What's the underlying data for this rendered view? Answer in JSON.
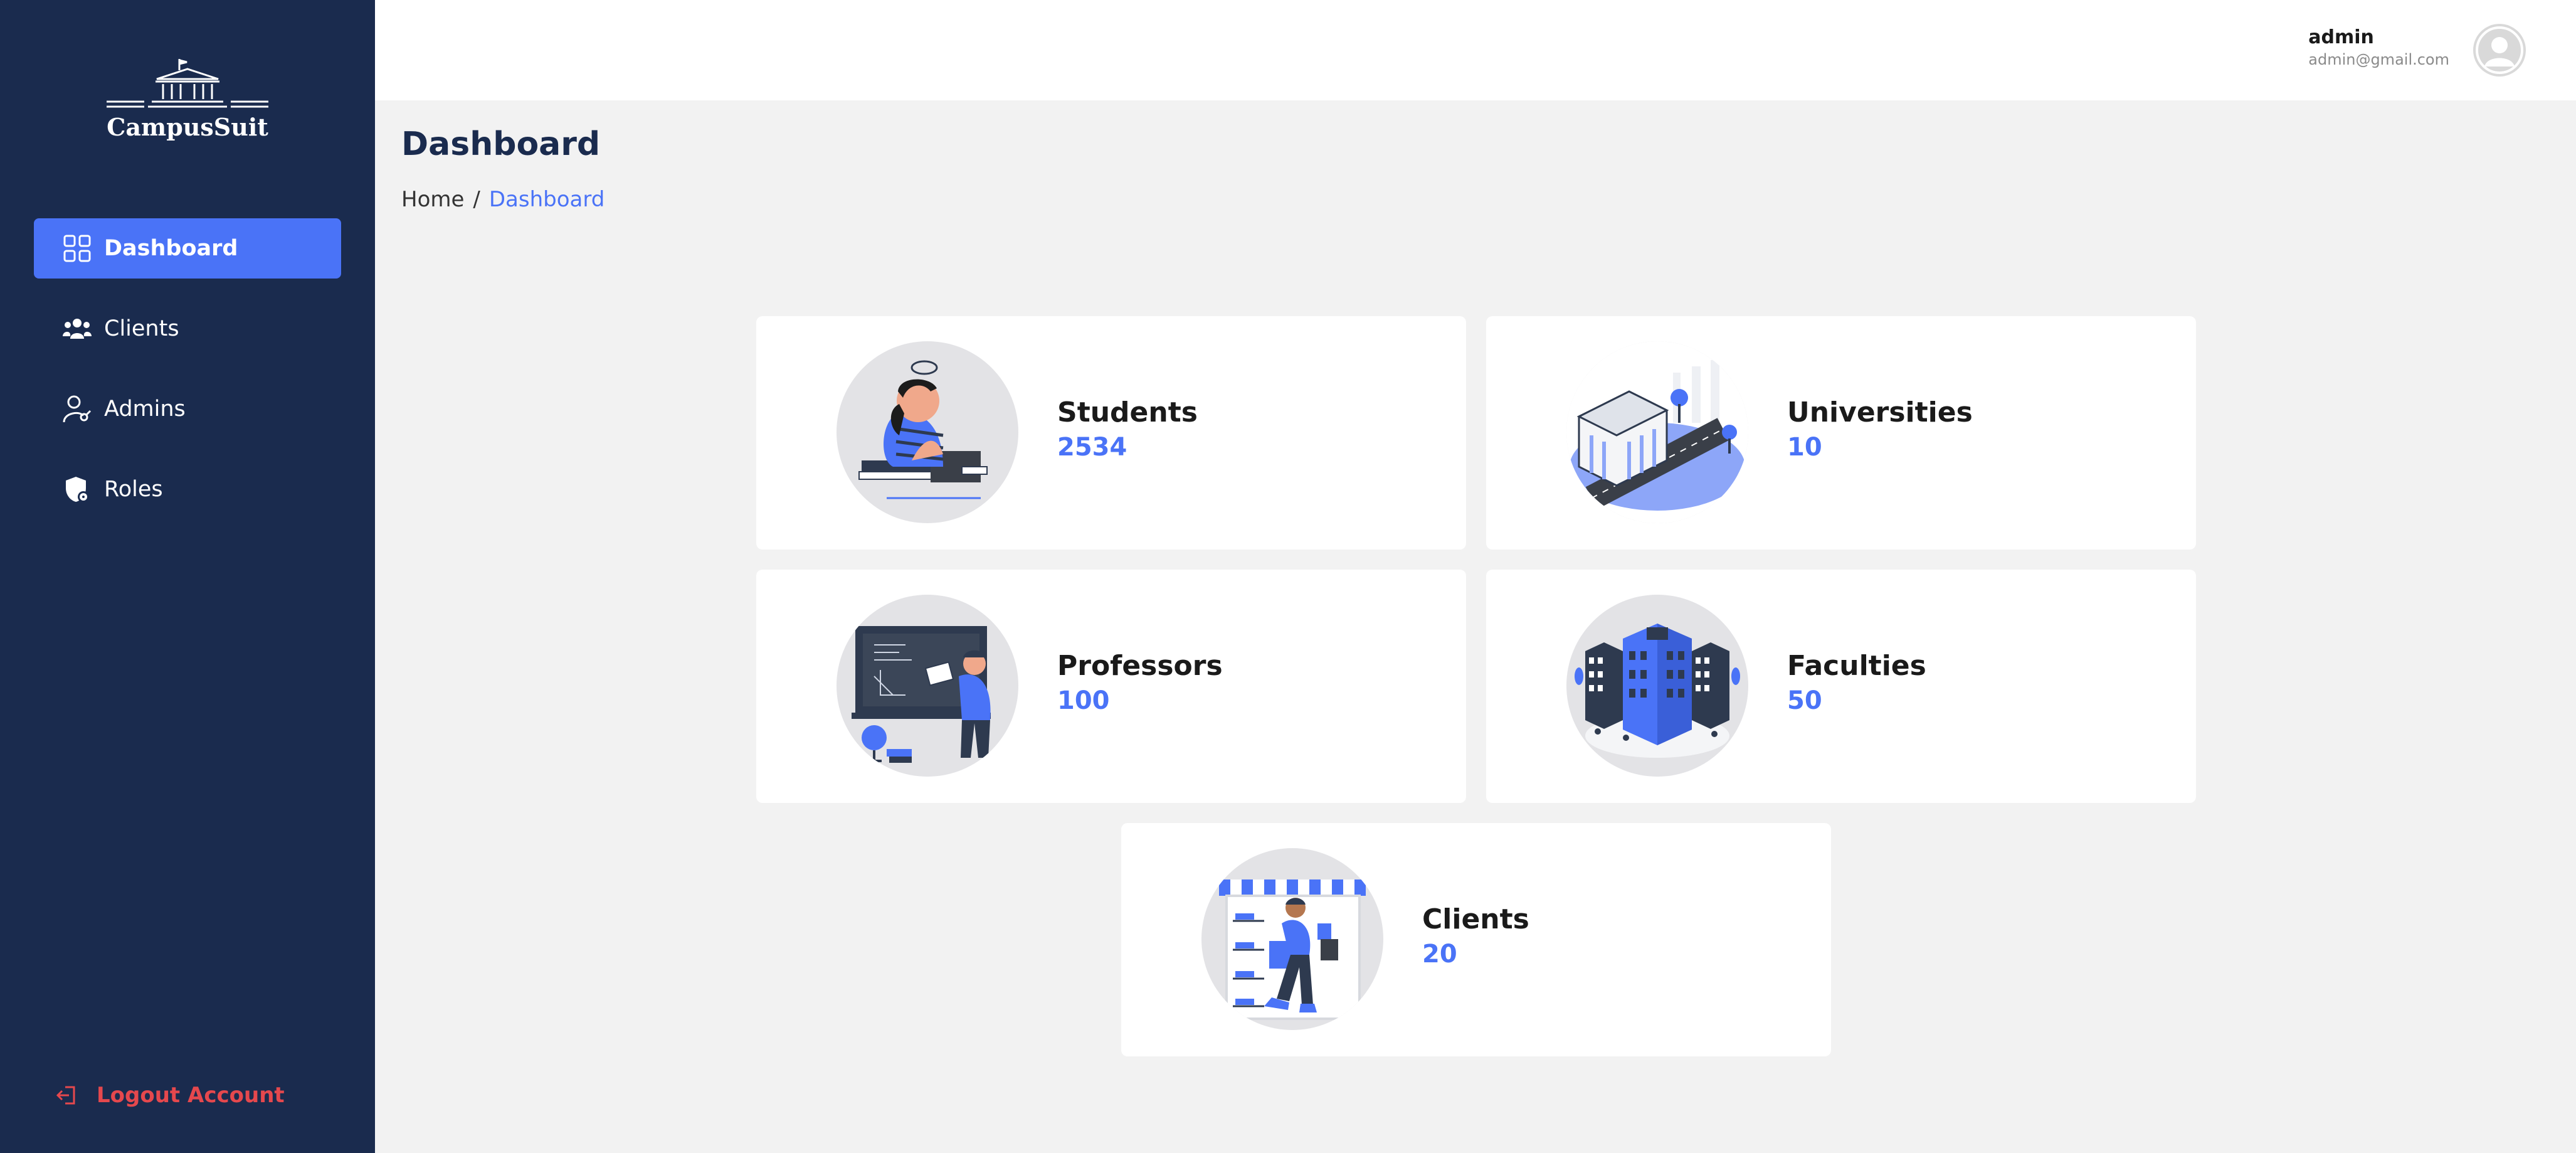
{
  "brand": {
    "name": "CampusSuit"
  },
  "sidebar": {
    "items": [
      {
        "label": "Dashboard",
        "icon": "dashboard-grid-icon",
        "active": true
      },
      {
        "label": "Clients",
        "icon": "users-icon",
        "active": false
      },
      {
        "label": "Admins",
        "icon": "admin-user-icon",
        "active": false
      },
      {
        "label": "Roles",
        "icon": "shield-icon",
        "active": false
      }
    ],
    "logout_label": "Logout Account"
  },
  "header": {
    "user_name": "admin",
    "user_email": "admin@gmail.com"
  },
  "page": {
    "title": "Dashboard",
    "breadcrumb": {
      "home": "Home",
      "separator": "/",
      "current": "Dashboard"
    }
  },
  "cards": {
    "students": {
      "label": "Students",
      "value": "2534"
    },
    "universities": {
      "label": "Universities",
      "value": "10"
    },
    "professors": {
      "label": "Professors",
      "value": "100"
    },
    "faculties": {
      "label": "Faculties",
      "value": "50"
    },
    "clients": {
      "label": "Clients",
      "value": "20"
    }
  },
  "colors": {
    "sidebar_bg": "#1a2b4e",
    "accent": "#4a73f7",
    "logout": "#e5484d",
    "page_bg": "#f2f2f2"
  }
}
